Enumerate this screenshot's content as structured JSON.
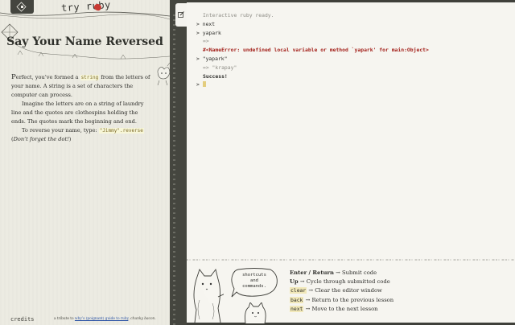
{
  "app": {
    "logo": "try ruby"
  },
  "lesson": {
    "title": "Say Your Name Reversed",
    "p1": {
      "dropcap": "P",
      "a": "erfect, you’ve formed a ",
      "code": "string",
      "b": " from the letters of your name. A string is a set of characters the computer can process."
    },
    "p2": "Imagine the letters are on a string of laundry line and the quotes are clothespins holding the ends. The quotes mark the beginning and end.",
    "p3": {
      "a": "To reverse your name, type: ",
      "code": "\"Jimmy\".reverse",
      "b": " (",
      "em": "Don’t forget the dot!",
      "c": ")"
    }
  },
  "footer": {
    "credits": "credits",
    "tribute_a": "a tribute to ",
    "tribute_link": "why’s (poignant) guide to ruby",
    "tribute_b": ", ",
    "tribute_em": "chunky bacon",
    "tribute_c": "."
  },
  "console": {
    "ready": "Interactive ruby ready.",
    "lines": [
      {
        "prompt": ">",
        "text": "next"
      },
      {
        "prompt": ">",
        "text": "yapark"
      },
      {
        "result": "=>"
      },
      {
        "error": "#<NameError: undefined local variable or method `yapark' for main:Object>"
      },
      {
        "prompt": ">",
        "text": "\"yapark\""
      },
      {
        "result": "=> \"krapay\""
      },
      {
        "success": "Success!"
      }
    ],
    "input_prompt": ">"
  },
  "bubble": {
    "line1": "shortcuts",
    "line2": "and",
    "line3": "commands."
  },
  "shortcuts": [
    {
      "key": "Enter / Return",
      "arrow": "→",
      "desc": "Submit code",
      "style": "bold"
    },
    {
      "key": "Up",
      "arrow": "→",
      "desc": "Cycle through submitted code",
      "style": "bold"
    },
    {
      "key": "clear",
      "arrow": "→",
      "desc": "Clear the editor window",
      "style": "code"
    },
    {
      "key": "back",
      "arrow": "→",
      "desc": "Return to the previous lesson",
      "style": "code"
    },
    {
      "key": "next",
      "arrow": "→",
      "desc": "Move to the next lesson",
      "style": "code"
    }
  ],
  "colors": {
    "accent": "#c83a33",
    "error": "#a4231d",
    "panel": "#ecebe2",
    "console": "#f6f5f0",
    "dark": "#3f403a"
  },
  "icons": {
    "nav": "diamond-menu-icon",
    "edit": "edit-icon",
    "ruby": "ruby-gem-icon"
  }
}
